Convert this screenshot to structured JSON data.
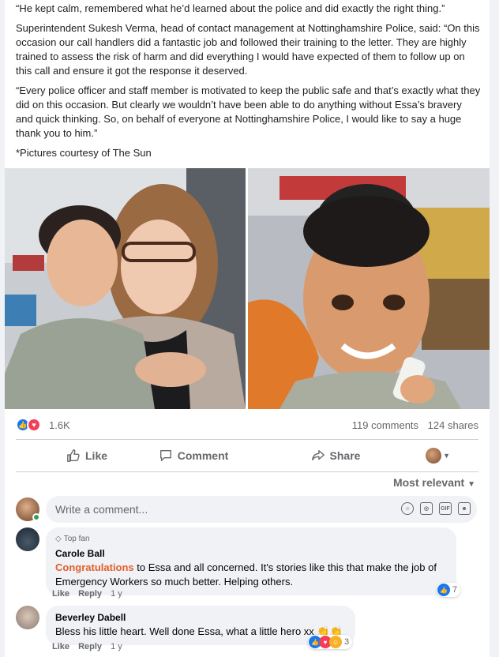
{
  "post": {
    "paragraphs": [
      "“He kept calm, remembered what he’d learned about the police and did exactly the right thing.”",
      "Superintendent Sukesh Verma, head of contact management at Nottinghamshire Police, said: “On this occasion our call handlers did a fantastic job and followed their training to the letter. They are highly trained to assess the risk of harm and did everything I would have expected of them to follow up on this call and ensure it got the response it deserved.",
      "“Every police officer and staff member is motivated to keep the public safe and that’s exactly what they did on this occasion. But clearly we wouldn’t have been able to do anything without Essa’s bravery and quick thinking. So, on behalf of everyone at Nottinghamshire Police, I would like to say a huge thank you to him.”",
      "*Pictures courtesy of The Sun"
    ]
  },
  "stats": {
    "reaction_count": "1.6K",
    "comments": "119 comments",
    "shares": "124 shares"
  },
  "actions": {
    "like": "Like",
    "comment": "Comment",
    "share": "Share"
  },
  "sort": {
    "label": "Most relevant"
  },
  "composer": {
    "placeholder": "Write a comment..."
  },
  "comments": [
    {
      "badge": "Top fan",
      "name": "Carole Ball",
      "highlight": "Congratulations",
      "text": " to Essa and all concerned. It's stories like this that make the job of Emergency Workers so much better. Helping others.",
      "like": "Like",
      "reply": "Reply",
      "time": "1 y",
      "reaction_count": "7"
    },
    {
      "name": "Beverley Dabell",
      "text": "Bless his little heart. Well done Essa, what a little hero xx 👏👏",
      "like": "Like",
      "reply": "Reply",
      "time": "1 y",
      "reaction_count": "3"
    }
  ],
  "colors": {
    "accent": "#1877f2",
    "love": "#f33e58",
    "highlight": "#e35f2a"
  }
}
